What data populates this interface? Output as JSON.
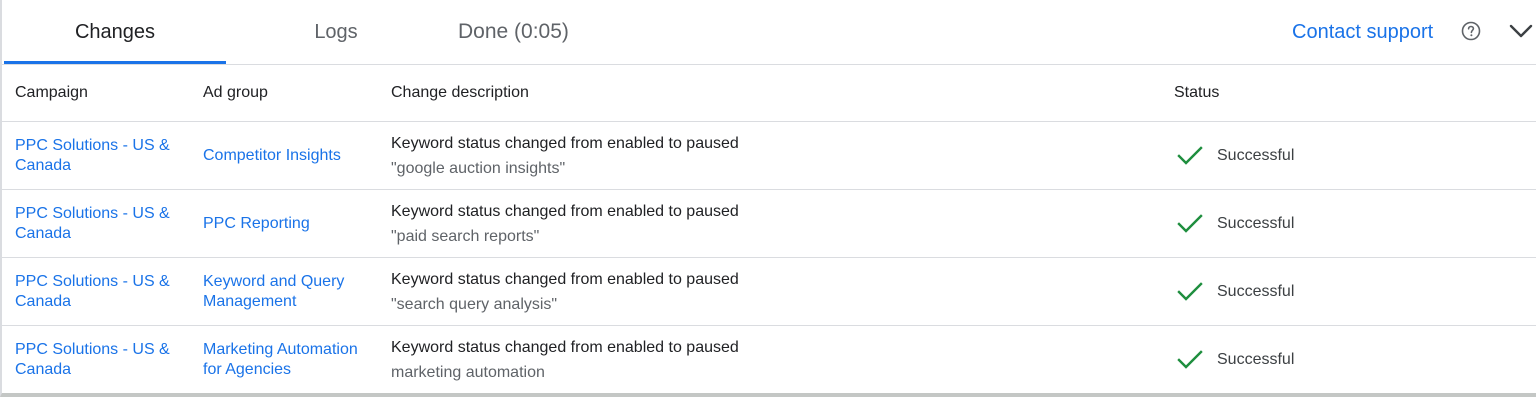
{
  "tabs": {
    "changes": "Changes",
    "logs": "Logs",
    "done": "Done (0:05)"
  },
  "header_actions": {
    "contact_support": "Contact support",
    "help_icon": "help-circle-icon",
    "collapse_icon": "chevron-down-icon"
  },
  "table": {
    "headers": {
      "campaign": "Campaign",
      "ad_group": "Ad group",
      "change_description": "Change description",
      "status": "Status"
    },
    "rows": [
      {
        "campaign": "PPC Solutions - US & Canada",
        "ad_group": "Competitor Insights",
        "change": "Keyword status changed from enabled to paused",
        "detail": "\"google auction insights\"",
        "status": "Successful"
      },
      {
        "campaign": "PPC Solutions - US & Canada",
        "ad_group": "PPC Reporting",
        "change": "Keyword status changed from enabled to paused",
        "detail": "\"paid search reports\"",
        "status": "Successful"
      },
      {
        "campaign": "PPC Solutions - US & Canada",
        "ad_group": "Keyword and Query Management",
        "change": "Keyword status changed from enabled to paused",
        "detail": "\"search query analysis\"",
        "status": "Successful"
      },
      {
        "campaign": "PPC Solutions - US & Canada",
        "ad_group": "Marketing Automation for Agencies",
        "change": "Keyword status changed from enabled to paused",
        "detail": "marketing automation",
        "status": "Successful"
      }
    ]
  },
  "colors": {
    "accent": "#1a73e8",
    "success": "#1e8e3e",
    "divider": "#dadce0"
  }
}
